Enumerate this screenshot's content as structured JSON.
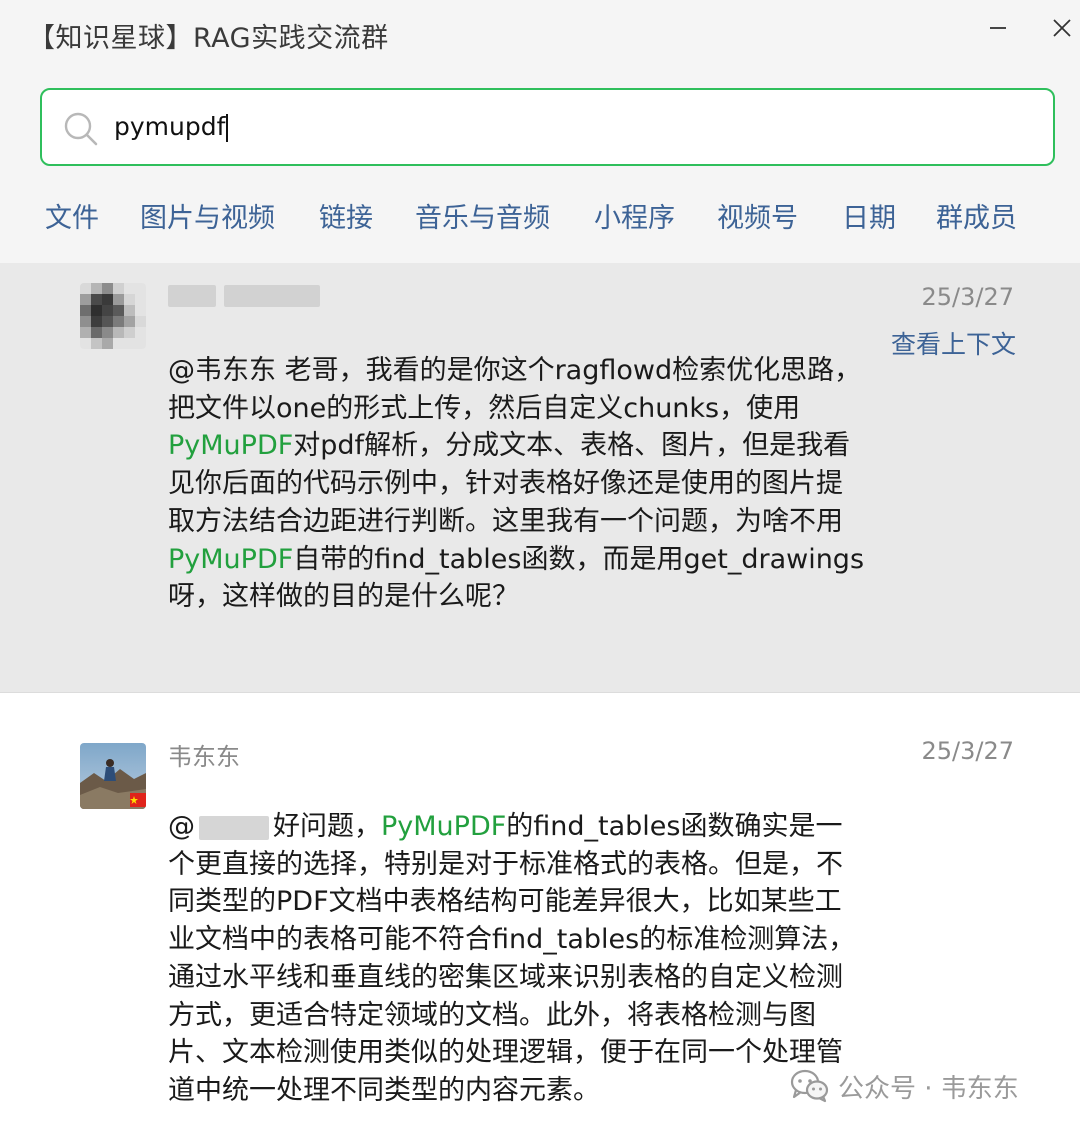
{
  "window": {
    "title": "【知识星球】RAG实践交流群",
    "minimize_glyph": "—",
    "close_glyph": "✕"
  },
  "search": {
    "value": "pymupdf"
  },
  "tabs": [
    "文件",
    "图片与视频",
    "链接",
    "音乐与音频",
    "小程序",
    "视频号",
    "日期",
    "群成员"
  ],
  "results": [
    {
      "date": "25/3/27",
      "context_link": "查看上下文",
      "parts": [
        "@韦东东 老哥，我看的是你这个ragflowd检索优化思路，把文件以one的形式上传，然后自定义chunks，使用",
        "PyMuPDF",
        "对pdf解析，分成文本、表格、图片，但是我看见你后面的代码示例中，针对表格好像还是使用的图片提取方法结合边距进行判断。这里我有一个问题，为啥不用",
        "PyMuPDF",
        "自带的find_tables函数，而是用get_drawings呀，这样做的目的是什么呢？"
      ]
    },
    {
      "sender": "韦东东",
      "date": "25/3/27",
      "mention_prefix": "@",
      "parts": [
        "好问题，",
        "PyMuPDF",
        "的find_tables函数确实是一个更直接的选择，特别是对于标准格式的表格。但是，不同类型的PDF文档中表格结构可能差异很大，比如某些工业文档中的表格可能不符合find_tables的标准检测算法，通过水平线和垂直线的密集区域来识别表格的自定义检测方式，更适合特定领域的文档。此外，将表格检测与图片、文本检测使用类似的处理逻辑，便于在同一个处理管道中统一处理不同类型的内容元素。"
      ]
    }
  ],
  "watermark": {
    "text": "公众号 · 韦东东"
  },
  "colors": {
    "accent_green": "#2fbf5c",
    "highlight_green": "#22a03e",
    "link_blue": "#3d6396"
  }
}
